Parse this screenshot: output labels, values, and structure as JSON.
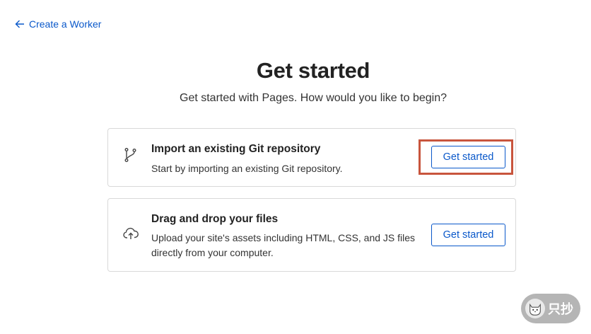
{
  "nav": {
    "back_label": "Create a Worker",
    "back_icon": "arrow-left-icon"
  },
  "header": {
    "title": "Get started",
    "subtitle": "Get started with Pages. How would you like to begin?"
  },
  "options": [
    {
      "icon": "git-branch-icon",
      "title": "Import an existing Git repository",
      "description": "Start by importing an existing Git repository.",
      "button_label": "Get started"
    },
    {
      "icon": "cloud-upload-icon",
      "title": "Drag and drop your files",
      "description": "Upload your site's assets including HTML, CSS, and JS files directly from your computer.",
      "button_label": "Get started"
    }
  ],
  "watermark": {
    "text": "只抄"
  },
  "colors": {
    "link": "#0a58ca",
    "highlight": "#c8553d",
    "border": "#d9d9d9"
  }
}
